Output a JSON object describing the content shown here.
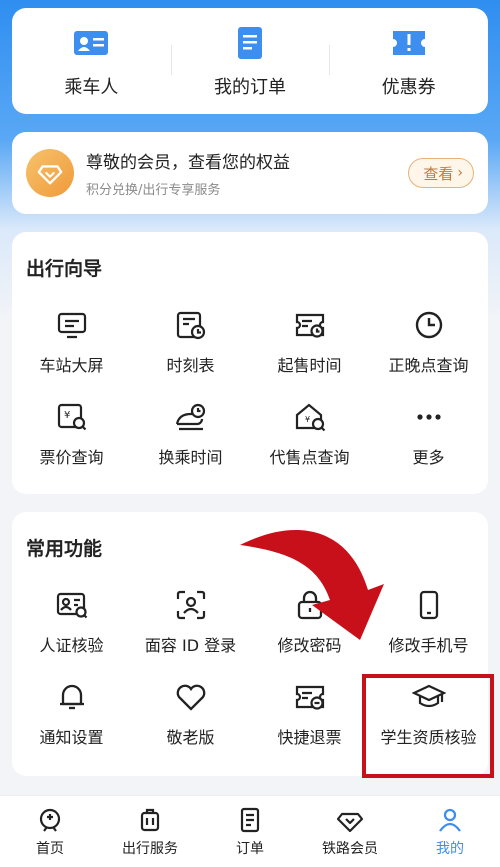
{
  "quick_links": [
    {
      "label": "乘车人",
      "icon": "passenger-card-icon"
    },
    {
      "label": "我的订单",
      "icon": "order-doc-icon"
    },
    {
      "label": "优惠券",
      "icon": "coupon-icon"
    }
  ],
  "member": {
    "title": "尊敬的会员，查看您的权益",
    "subtitle": "积分兑换/出行专享服务",
    "button": "查看"
  },
  "guide": {
    "title": "出行向导",
    "items": [
      {
        "label": "车站大屏",
        "icon": "station-screen-icon"
      },
      {
        "label": "时刻表",
        "icon": "timetable-icon"
      },
      {
        "label": "起售时间",
        "icon": "sale-time-icon"
      },
      {
        "label": "正晚点查询",
        "icon": "clock-icon"
      },
      {
        "label": "票价查询",
        "icon": "fare-search-icon"
      },
      {
        "label": "换乘时间",
        "icon": "transfer-time-icon"
      },
      {
        "label": "代售点查询",
        "icon": "agency-search-icon"
      },
      {
        "label": "更多",
        "icon": "more-dots-icon"
      }
    ]
  },
  "functions": {
    "title": "常用功能",
    "items": [
      {
        "label": "人证核验",
        "icon": "id-verify-icon"
      },
      {
        "label": "面容 ID 登录",
        "icon": "face-id-icon"
      },
      {
        "label": "修改密码",
        "icon": "lock-icon"
      },
      {
        "label": "修改手机号",
        "icon": "phone-icon"
      },
      {
        "label": "通知设置",
        "icon": "bell-icon"
      },
      {
        "label": "敬老版",
        "icon": "heart-icon"
      },
      {
        "label": "快捷退票",
        "icon": "refund-ticket-icon"
      },
      {
        "label": "学生资质核验",
        "icon": "graduation-cap-icon"
      }
    ]
  },
  "tabs": [
    {
      "label": "首页",
      "icon": "home-train-icon"
    },
    {
      "label": "出行服务",
      "icon": "luggage-icon"
    },
    {
      "label": "订单",
      "icon": "order-list-icon"
    },
    {
      "label": "铁路会员",
      "icon": "diamond-icon"
    },
    {
      "label": "我的",
      "icon": "user-icon",
      "active": true
    }
  ],
  "colors": {
    "accent": "#3e8ef0",
    "highlight": "#c8101a",
    "member_gold": "#f09a3a"
  }
}
